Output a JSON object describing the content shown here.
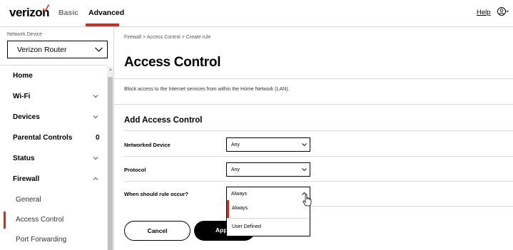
{
  "header": {
    "logo_text": "verizon",
    "tabs": [
      {
        "label": "Basic",
        "active": false
      },
      {
        "label": "Advanced",
        "active": true
      }
    ],
    "help_label": "Help",
    "brand_color": "#d52b1e"
  },
  "sidebar": {
    "network_device_label": "Network Device",
    "selected_device": "Verizon Router",
    "menu": [
      {
        "label": "Home"
      },
      {
        "label": "Wi-Fi",
        "icon": "chevron-down-icon"
      },
      {
        "label": "Devices",
        "icon": "chevron-down-icon"
      },
      {
        "label": "Parental Controls",
        "count": "0"
      },
      {
        "label": "Status",
        "icon": "chevron-down-icon"
      },
      {
        "label": "Firewall",
        "icon": "chevron-up-icon",
        "expanded": true
      }
    ],
    "firewall_submenu": [
      {
        "label": "General",
        "active": false
      },
      {
        "label": "Access Control",
        "active": true
      },
      {
        "label": "Port Forwarding",
        "active": false
      }
    ]
  },
  "main": {
    "breadcrumb": "Firewall  >  Access Control  >  Create rule",
    "title": "Access Control",
    "intro": "Block access to the Internet services from within the Home Network (LAN).",
    "section_title": "Add Access Control",
    "fields": [
      {
        "label": "Networked Device",
        "value": "Any"
      },
      {
        "label": "Protocol",
        "value": "Any"
      },
      {
        "label": "When should rule occur?",
        "value": "Always",
        "open": true
      }
    ],
    "rule_options": [
      {
        "label": "Always",
        "selected": true
      },
      {
        "label": "User Defined",
        "selected": false
      }
    ],
    "buttons": {
      "cancel": "Cancel",
      "apply": "Apply"
    }
  }
}
